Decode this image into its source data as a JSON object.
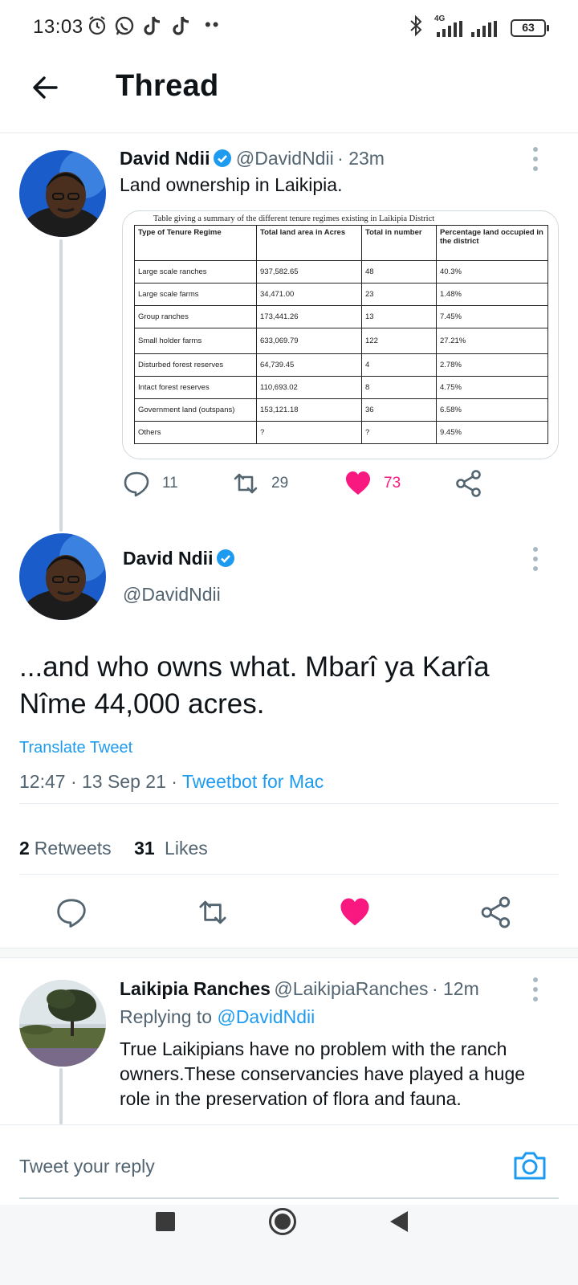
{
  "status_bar": {
    "time": "13:03",
    "network": "4G",
    "battery": "63",
    "icons": [
      "alarm-icon",
      "whatsapp-icon",
      "tiktok-icon",
      "tiktok-icon",
      "more-dots-icon",
      "bluetooth-icon",
      "signal-icon",
      "signal-icon"
    ]
  },
  "header": {
    "title": "Thread",
    "back_icon": "arrow-left-icon"
  },
  "tweet1": {
    "name": "David Ndii",
    "handle": "@DavidNdii",
    "time": "· 23m",
    "text": "Land ownership in Laikipia.",
    "media": {
      "caption": "Table giving a summary of the different tenure regimes existing in Laikipia District",
      "headers": [
        "Type of Tenure Regime",
        "Total land area in Acres",
        "Total in number",
        "Percentage land occupied in the district"
      ],
      "rows": [
        [
          "Large scale ranches",
          "937,582.65",
          "48",
          "40.3%"
        ],
        [
          "Large scale farms",
          "34,471.00",
          "23",
          "1.48%"
        ],
        [
          "Group ranches",
          "173,441.26",
          "13",
          "7.45%"
        ],
        [
          "Small holder farms",
          "633,069.79",
          "122",
          "27.21%"
        ],
        [
          "Disturbed forest reserves",
          "64,739.45",
          "4",
          "2.78%"
        ],
        [
          "Intact forest reserves",
          "110,693.02",
          "8",
          "4.75%"
        ],
        [
          "Government land (outspans)",
          "153,121.18",
          "36",
          "6.58%"
        ],
        [
          "Others",
          "?",
          "?",
          "9.45%"
        ]
      ]
    },
    "actions": {
      "replies": "11",
      "retweets": "29",
      "likes": "73"
    }
  },
  "tweet2": {
    "name": "David Ndii",
    "handle": "@DavidNdii",
    "text": "...and who owns what. Mbarî ya Karîa Nîme 44,000 acres.",
    "translate": "Translate Tweet",
    "timestamp": "12:47 · 13 Sep 21 · ",
    "source": "Tweetbot for Mac",
    "retweets_count": "2",
    "retweets_label": "Retweets",
    "likes_count": "31",
    "likes_label": "Likes"
  },
  "tweet3": {
    "name": "Laikipia Ranches",
    "handle": "@LaikipiaRanches",
    "time": "· 12m",
    "replying_label": "Replying to ",
    "replying_to": "@DavidNdii",
    "text": "True Laikipians have no problem with the ranch owners.These conservancies have played a huge role in the preservation of flora and fauna."
  },
  "reply_bar": {
    "placeholder": "Tweet your reply"
  },
  "colors": {
    "accent": "#1d9bf0",
    "like": "#f91880",
    "text": "#0f1419",
    "muted": "#536471"
  }
}
